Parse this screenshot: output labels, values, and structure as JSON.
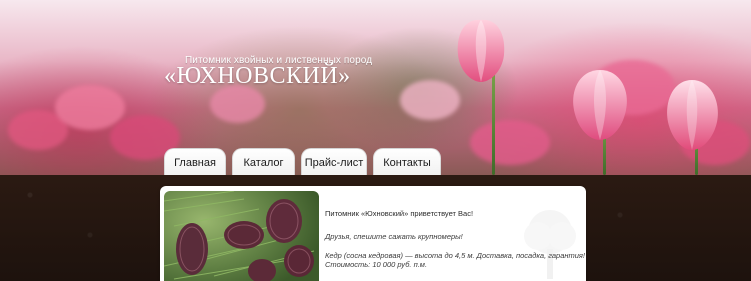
{
  "header": {
    "subtitle": "Питомник хвойных и лиственных пород",
    "brand": "«ЮХНОВСКИЙ»"
  },
  "nav": {
    "tabs": [
      {
        "label": "Главная"
      },
      {
        "label": "Каталог"
      },
      {
        "label": "Прайс-лист"
      },
      {
        "label": "Контакты"
      }
    ]
  },
  "content": {
    "welcome": "Питомник «Юхновский» приветствует Вас!",
    "promo": "Друзья, спешите сажать крупномеры!",
    "item_line1": "Кедр (сосна кедровая) — высота до 4,5 м. Доставка, посадка, гарантия!",
    "item_line2": "Стоимость: 10 000 руб. п.м."
  }
}
